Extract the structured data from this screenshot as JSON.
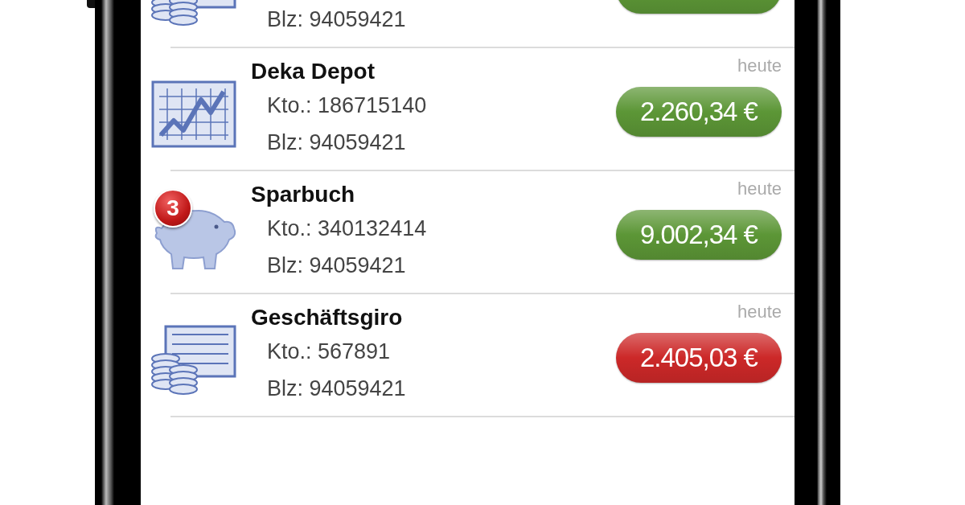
{
  "top_row": {
    "kind": "giro",
    "blz": "Blz: 94059421",
    "color": "#5c9636"
  },
  "accounts": [
    {
      "kind": "chart",
      "name": "Deka Depot",
      "kto": "Kto.: 186715140",
      "blz": "Blz: 94059421",
      "date": "heute",
      "balance": "2.260,34 €",
      "color": "#5c9636"
    },
    {
      "kind": "pig",
      "badge": "3",
      "name": "Sparbuch",
      "kto": "Kto.: 340132414",
      "blz": "Blz: 94059421",
      "date": "heute",
      "balance": "9.002,34 €",
      "color": "#5c9636"
    },
    {
      "kind": "giro",
      "name": "Geschäftsgiro",
      "kto": "Kto.: 567891",
      "blz": "Blz: 94059421",
      "date": "heute",
      "balance": "2.405,03 €",
      "color": "#cc2828"
    }
  ]
}
